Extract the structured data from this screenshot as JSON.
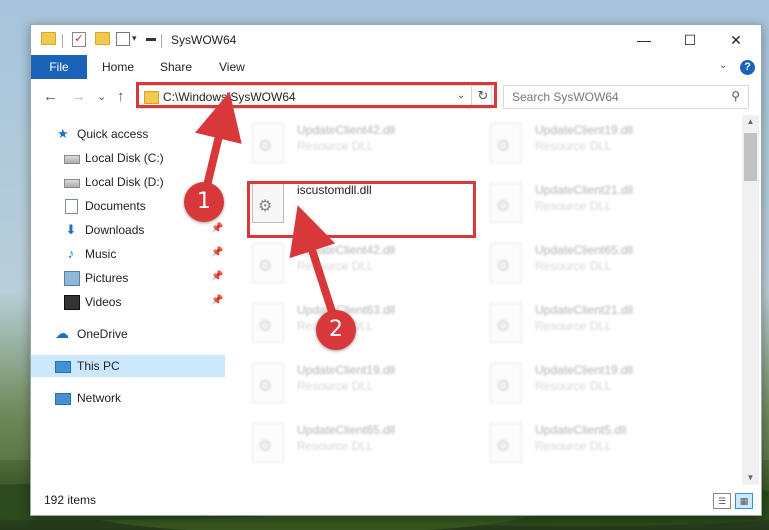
{
  "window": {
    "title": "SysWOW64",
    "controls": {
      "minimize": "—",
      "maximize": "☐",
      "close": "✕"
    }
  },
  "ribbon": {
    "file_tab": "File",
    "tabs": [
      "Home",
      "Share",
      "View"
    ],
    "help": "?"
  },
  "navigation": {
    "back": "←",
    "forward": "→",
    "recent": "⌄",
    "up": "↑",
    "address": "C:\\Windows\\SysWOW64",
    "refresh": "↻",
    "search_placeholder": "Search SysWOW64"
  },
  "sidebar": {
    "items": [
      {
        "label": "Quick access",
        "icon": "star-icon",
        "pinned": false
      },
      {
        "label": "Local Disk (C:)",
        "icon": "disk-icon",
        "pinned": false
      },
      {
        "label": "Local Disk (D:)",
        "icon": "disk-icon",
        "pinned": false
      },
      {
        "label": "Documents",
        "icon": "document-icon",
        "pinned": true
      },
      {
        "label": "Downloads",
        "icon": "download-icon",
        "pinned": true
      },
      {
        "label": "Music",
        "icon": "music-icon",
        "pinned": true
      },
      {
        "label": "Pictures",
        "icon": "pictures-icon",
        "pinned": true
      },
      {
        "label": "Videos",
        "icon": "videos-icon",
        "pinned": true
      },
      {
        "label": "OneDrive",
        "icon": "onedrive-icon",
        "pinned": false
      },
      {
        "label": "This PC",
        "icon": "this-pc-icon",
        "pinned": false,
        "selected": true
      },
      {
        "label": "Network",
        "icon": "network-icon",
        "pinned": false
      }
    ]
  },
  "files": {
    "left_column": [
      {
        "name": "UpdateClient42.dll",
        "type": "Resource DLL"
      },
      {
        "name": "iscustomdll.dll",
        "type": ""
      },
      {
        "name": "UpdateClient42.dll",
        "type": "Resource DLL"
      },
      {
        "name": "UpdateClient63.dll",
        "type": "Resource DLL"
      },
      {
        "name": "UpdateClient19.dll",
        "type": "Resource DLL"
      },
      {
        "name": "UpdateClient65.dll",
        "type": "Resource DLL"
      }
    ],
    "right_column": [
      {
        "name": "UpdateClient19.dll",
        "type": "Resource DLL"
      },
      {
        "name": "UpdateClient21.dll",
        "type": "Resource DLL"
      },
      {
        "name": "UpdateClient65.dll",
        "type": "Resource DLL"
      },
      {
        "name": "UpdateClient21.dll",
        "type": "Resource DLL"
      },
      {
        "name": "UpdateClient19.dll",
        "type": "Resource DLL"
      },
      {
        "name": "UpdateClient5.dll",
        "type": "Resource DLL"
      }
    ]
  },
  "status": {
    "item_count": "192 items"
  },
  "annotations": {
    "step1": "1",
    "step2": "2",
    "color": "#d9383a"
  }
}
